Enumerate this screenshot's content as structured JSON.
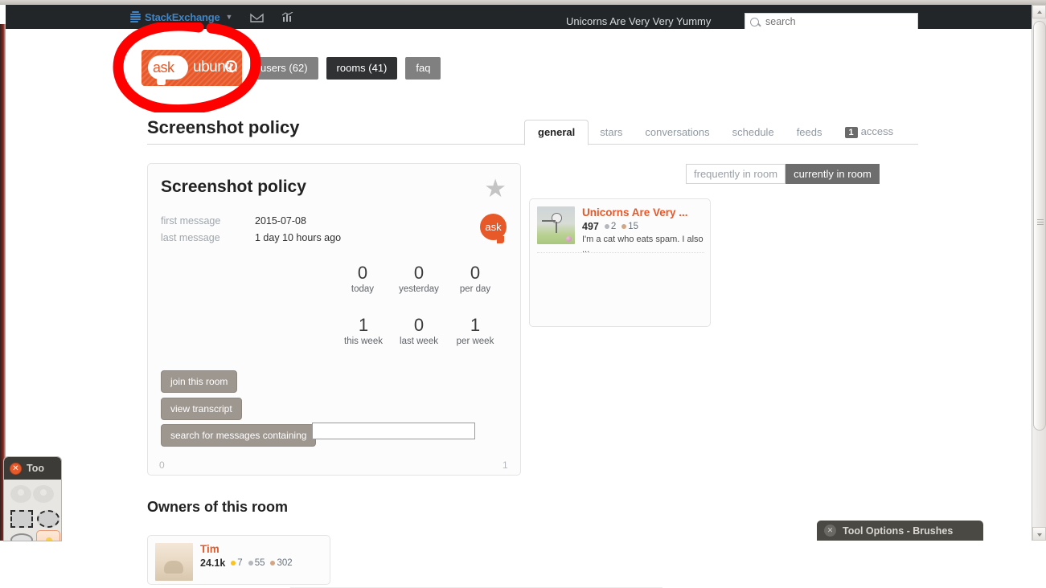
{
  "topbar": {
    "logo_icon": "stackexchange-logo-icon",
    "site_name": "StackExchange",
    "caret_icon": "chevron-down-icon",
    "inbox_icon": "inbox-icon",
    "achievements_icon": "achievements-chart-icon",
    "room_title": "Unicorns Are Very Very Yummy",
    "search_icon": "search-icon",
    "search_placeholder": "search",
    "search_value": ""
  },
  "header": {
    "logo_icon": "ask-ubuntu-logo-icon",
    "logo_ask": "ask",
    "logo_ubuntu": "ubuntu",
    "nav": [
      {
        "label": "users (62)",
        "style": "grey"
      },
      {
        "label": "rooms (41)",
        "style": "dark"
      },
      {
        "label": "faq",
        "style": "grey"
      }
    ],
    "page_title": "Screenshot policy"
  },
  "tabs": [
    {
      "label": "general",
      "active": true,
      "badge": ""
    },
    {
      "label": "stars",
      "active": false,
      "badge": ""
    },
    {
      "label": "conversations",
      "active": false,
      "badge": ""
    },
    {
      "label": "schedule",
      "active": false,
      "badge": ""
    },
    {
      "label": "feeds",
      "active": false,
      "badge": ""
    },
    {
      "label": "access",
      "active": false,
      "badge": "1"
    }
  ],
  "room_card": {
    "title": "Screenshot policy",
    "star_icon": "star-icon",
    "site_badge_icon": "ask-ubuntu-badge-icon",
    "site_badge_text": "ask",
    "meta": [
      {
        "label": "first message",
        "value": "2015-07-08"
      },
      {
        "label": "last message",
        "value": "1 day 10 hours ago"
      }
    ],
    "stats": [
      {
        "value": "0",
        "label": "today"
      },
      {
        "value": "0",
        "label": "yesterday"
      },
      {
        "value": "0",
        "label": "per day"
      },
      {
        "value": "1",
        "label": "this week"
      },
      {
        "value": "0",
        "label": "last week"
      },
      {
        "value": "1",
        "label": "per week"
      }
    ],
    "join_button": "join this room",
    "transcript_button": "view transcript",
    "search_button": "search for messages containing",
    "search_value": "",
    "footer_left": "0",
    "footer_right": "1"
  },
  "people": {
    "toggle_frequently": "frequently in room",
    "toggle_currently": "currently in room",
    "users": [
      {
        "name": "Unicorns Are Very ...",
        "reputation": "497",
        "silver": "2",
        "bronze": "15",
        "bio": "I'm a cat who eats spam. I also ..."
      }
    ]
  },
  "owners": {
    "heading": "Owners of this room",
    "list": [
      {
        "name": "Tim",
        "reputation": "24.1k",
        "gold": "7",
        "silver": "55",
        "bronze": "302"
      }
    ]
  },
  "gimp": {
    "toolbox_title": "Too",
    "toolbox_close_icon": "close-icon",
    "tools": [
      "rectangle-select-tool-icon",
      "ellipse-select-tool-icon",
      "free-select-tool-icon",
      "active-tool-icon"
    ],
    "tool_options_title": "Tool Options - Brushes",
    "tool_options_close_icon": "close-icon"
  },
  "scrollbar": {
    "up_icon": "scroll-up-arrow-icon",
    "down_icon": "scroll-down-arrow-icon",
    "grip_icon": "scrollbar-grip-icon"
  },
  "annotation": {
    "shape": "red-circle-annotation",
    "color": "#ff0000"
  }
}
